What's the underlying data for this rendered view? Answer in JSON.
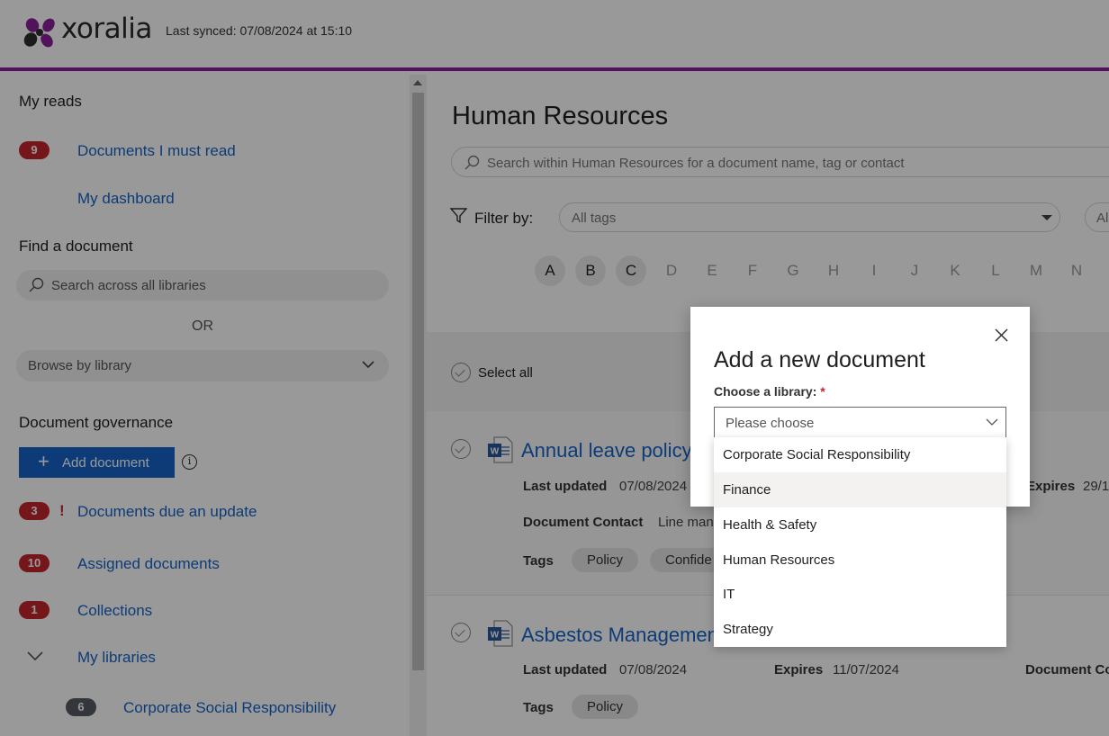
{
  "header": {
    "brand": "xoralia",
    "last_synced": "Last synced: 07/08/2024 at 15:10"
  },
  "sidebar": {
    "my_reads_title": "My reads",
    "must_read": {
      "count": "9",
      "label": "Documents I must read"
    },
    "dashboard_label": "My dashboard",
    "find_title": "Find a document",
    "search_placeholder": "Search across all libraries",
    "or_label": "OR",
    "browse_placeholder": "Browse by library",
    "governance_title": "Document governance",
    "add_document_label": "Add document",
    "due_update": {
      "count": "3",
      "label": "Documents due an update"
    },
    "assigned": {
      "count": "10",
      "label": "Assigned documents"
    },
    "collections": {
      "count": "1",
      "label": "Collections"
    },
    "my_libraries_label": "My libraries",
    "library_item": {
      "count": "6",
      "label": "Corporate Social Responsibility"
    }
  },
  "main": {
    "title": "Human Resources",
    "search_placeholder": "Search within Human Resources for a document name, tag or contact",
    "filter_label": "Filter by:",
    "tags_placeholder": "All tags",
    "second_filter_placeholder": "Al",
    "letters": [
      {
        "l": "A",
        "active": true
      },
      {
        "l": "B",
        "active": true
      },
      {
        "l": "C",
        "active": true
      },
      {
        "l": "D",
        "active": false
      },
      {
        "l": "E",
        "active": false
      },
      {
        "l": "F",
        "active": false
      },
      {
        "l": "G",
        "active": false
      },
      {
        "l": "H",
        "active": false
      },
      {
        "l": "I",
        "active": false
      },
      {
        "l": "J",
        "active": false
      },
      {
        "l": "K",
        "active": false
      },
      {
        "l": "L",
        "active": false
      },
      {
        "l": "M",
        "active": false
      },
      {
        "l": "N",
        "active": false
      }
    ],
    "select_all_label": "Select all",
    "documents": [
      {
        "title": "Annual leave policy",
        "last_updated_label": "Last updated",
        "last_updated": "07/08/2024",
        "expires_label": "Expires",
        "expires": "29/1",
        "contact_label": "Document Contact",
        "contact": "Line man",
        "tags_label": "Tags",
        "tags": [
          "Policy",
          "Confide"
        ]
      },
      {
        "title": "Asbestos Managemen",
        "last_updated_label": "Last updated",
        "last_updated": "07/08/2024",
        "expires_label": "Expires",
        "expires": "11/07/2024",
        "contact_label": "Document Co",
        "tags_label": "Tags",
        "tags": [
          "Policy"
        ]
      }
    ]
  },
  "dialog": {
    "title": "Add a new document",
    "library_label": "Choose a library:",
    "required_mark": "*",
    "select_placeholder": "Please choose",
    "options": [
      {
        "label": "Corporate Social Responsibility",
        "hover": false
      },
      {
        "label": "Finance",
        "hover": true
      },
      {
        "label": "Health & Safety",
        "hover": false
      },
      {
        "label": "Human Resources",
        "hover": false
      },
      {
        "label": "IT",
        "hover": false
      },
      {
        "label": "Strategy",
        "hover": false
      }
    ]
  },
  "colors": {
    "brand_purple": "#8a1f9a",
    "link_blue": "#1763c8",
    "badge_red": "#c4262e",
    "badge_grey": "#555b61"
  }
}
